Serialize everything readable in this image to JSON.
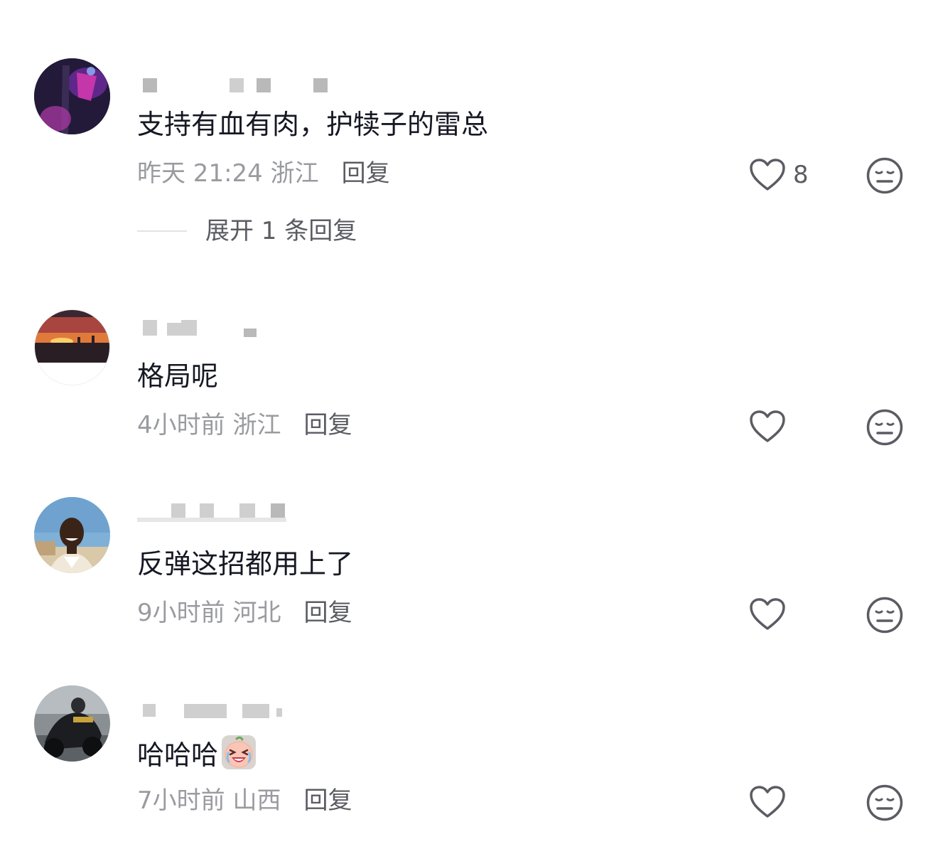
{
  "comments": [
    {
      "text": "支持有血有肉，护犊子的雷总",
      "time": "昨天 21:24 浙江",
      "reply": "回复",
      "likes": "8",
      "expand": "展开 1 条回复"
    },
    {
      "text": "格局呢",
      "time": "4小时前 浙江",
      "reply": "回复"
    },
    {
      "text": "反弹这招都用上了",
      "time": "9小时前 河北",
      "reply": "回复"
    },
    {
      "text": "哈哈哈",
      "time": "7小时前 山西",
      "reply": "回复",
      "emoji": "crying-laughing-emoji"
    }
  ],
  "icons": {
    "like": "heart-icon",
    "dislike": "meh-face-icon"
  },
  "colors": {
    "text": "#161823",
    "meta": "#9a9ba0",
    "reply": "#5b5c63"
  }
}
